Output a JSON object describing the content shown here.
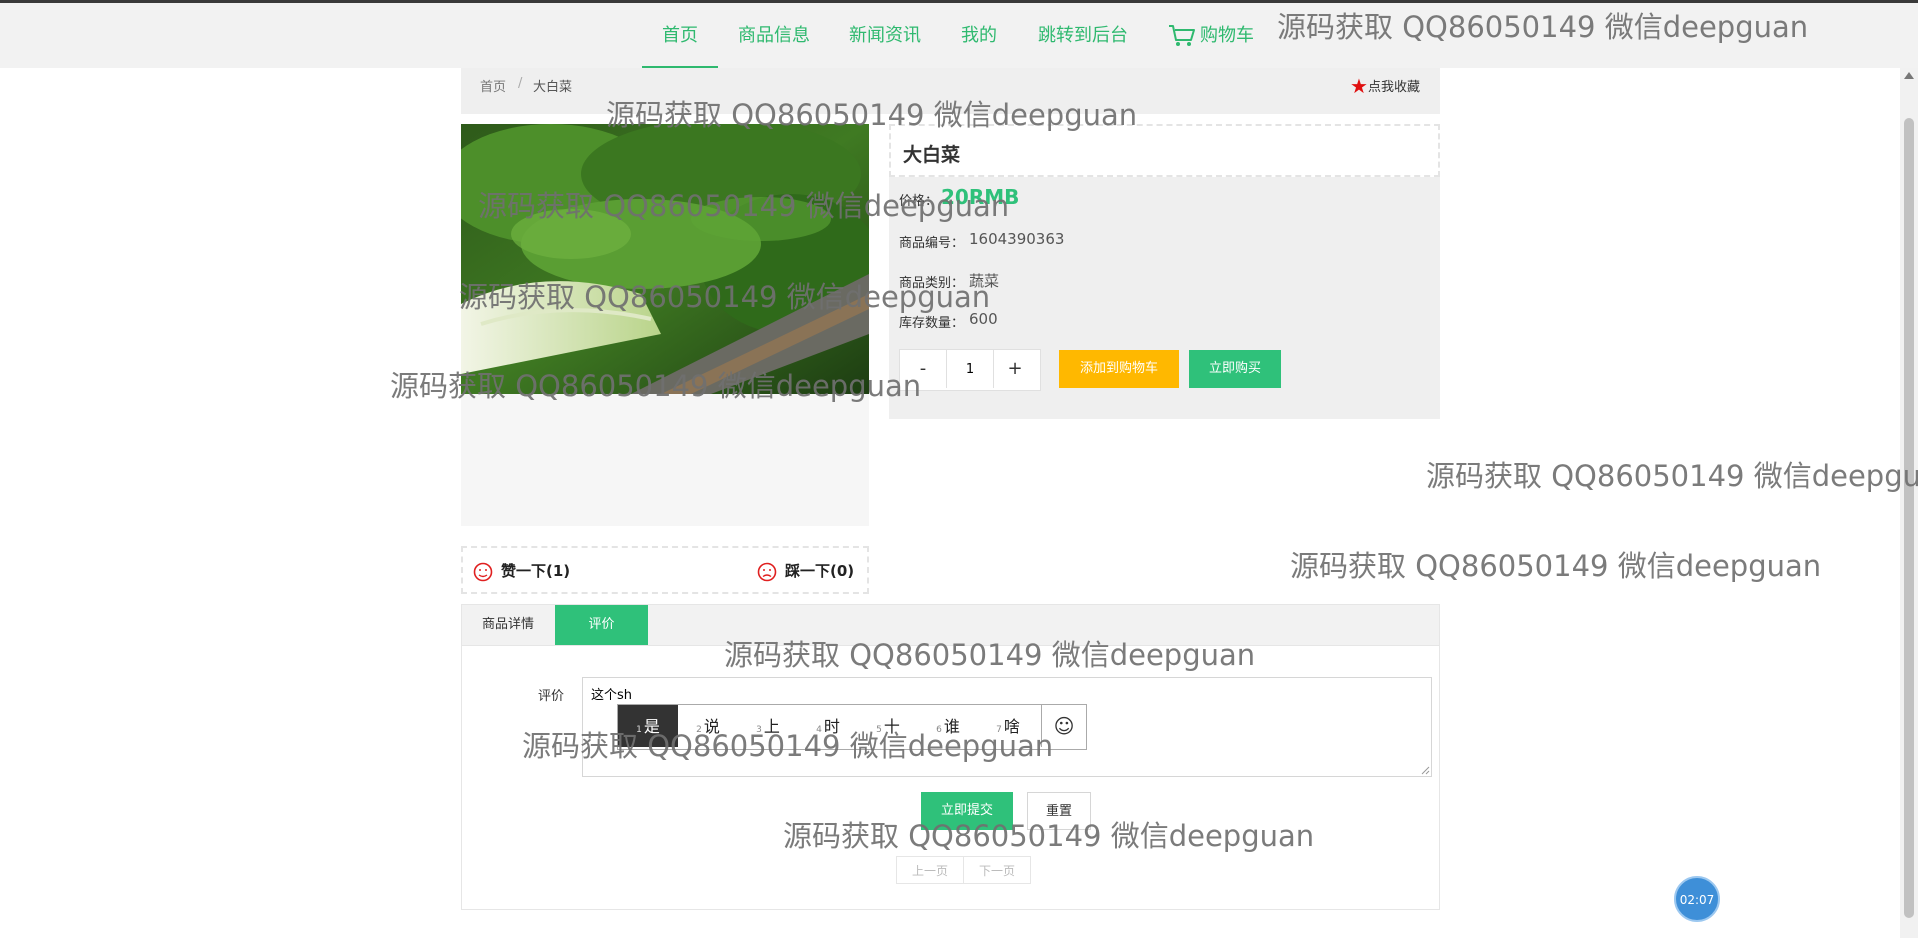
{
  "nav": {
    "home": "首页",
    "products": "商品信息",
    "news": "新闻资讯",
    "mine": "我的",
    "admin": "跳转到后台",
    "cart": "购物车"
  },
  "breadcrumb": {
    "home": "首页",
    "sep": "/",
    "current": "大白菜"
  },
  "favorite": "点我收藏",
  "product": {
    "name": "大白菜",
    "price_label": "价格：",
    "price": "20RMB",
    "code_label": "商品编号：",
    "code": "1604390363",
    "category_label": "商品类别：",
    "category": "蔬菜",
    "stock_label": "库存数量：",
    "stock": "600"
  },
  "quantity": {
    "minus": "-",
    "value": "1",
    "plus": "+"
  },
  "buttons": {
    "add_cart": "添加到购物车",
    "buy_now": "立即购买"
  },
  "likes": {
    "like": "赞一下(1)",
    "dislike": "踩一下(0)"
  },
  "tabs": {
    "detail": "商品详情",
    "review": "评价"
  },
  "review": {
    "label": "评价",
    "typed": "这个sh",
    "submit": "立即提交",
    "reset": "重置",
    "prev": "上一页",
    "next": "下一页"
  },
  "ime": {
    "candidates": [
      {
        "num": "1",
        "text": "是"
      },
      {
        "num": "2",
        "text": "说"
      },
      {
        "num": "3",
        "text": "上"
      },
      {
        "num": "4",
        "text": "时"
      },
      {
        "num": "5",
        "text": "十"
      },
      {
        "num": "6",
        "text": "谁"
      },
      {
        "num": "7",
        "text": "啥"
      }
    ],
    "emoji": "☺"
  },
  "timer": "02:07",
  "watermark": "源码获取 QQ86050149 微信deepguan",
  "colors": {
    "accent": "#2fc17a",
    "nav_text": "#2fb96f",
    "orange": "#ffb800",
    "star": "#e01010"
  }
}
